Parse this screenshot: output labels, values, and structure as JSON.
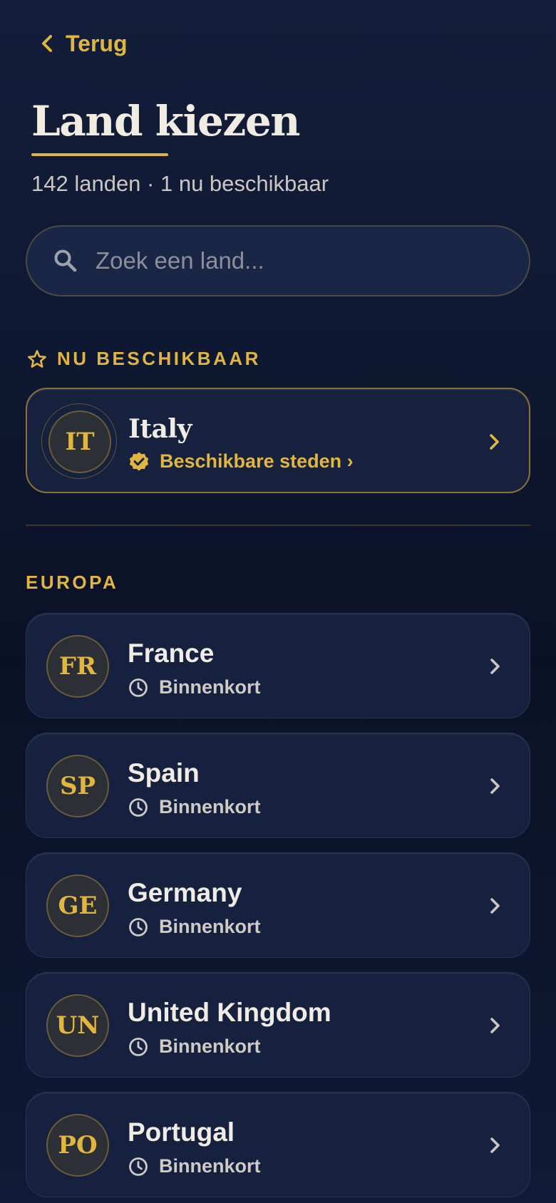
{
  "header": {
    "back_label": "Terug",
    "title": "Land kiezen",
    "subtitle": "142 landen · 1 nu beschikbaar"
  },
  "search": {
    "placeholder": "Zoek een land..."
  },
  "featured": {
    "section_label": "NU BESCHIKBAAR",
    "item": {
      "code": "IT",
      "name": "Italy",
      "status": "Beschikbare steden ›"
    }
  },
  "europa": {
    "section_label": "EUROPA",
    "items": [
      {
        "code": "FR",
        "name": "France",
        "status": "Binnenkort"
      },
      {
        "code": "SP",
        "name": "Spain",
        "status": "Binnenkort"
      },
      {
        "code": "GE",
        "name": "Germany",
        "status": "Binnenkort"
      },
      {
        "code": "UN",
        "name": "United Kingdom",
        "status": "Binnenkort"
      },
      {
        "code": "PO",
        "name": "Portugal",
        "status": "Binnenkort"
      }
    ]
  },
  "colors": {
    "accent": "#e2b53e",
    "background": "#0e1730",
    "card": "#15213f",
    "text": "#f0ece4",
    "muted": "#cfcbc4"
  },
  "icons": {
    "back": "chevron-left-icon",
    "search": "search-icon",
    "featured_section": "star-outline-icon",
    "verified": "verified-badge-icon",
    "soon": "clock-icon",
    "row_arrow": "chevron-right-icon"
  }
}
